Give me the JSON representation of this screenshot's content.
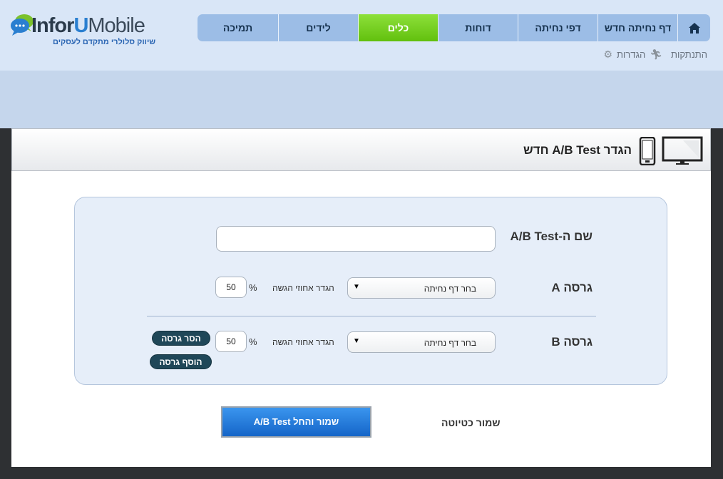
{
  "brand": {
    "name_part1": "Infor",
    "name_part2": "U",
    "name_part3": "Mobile",
    "tagline": "שיווק סלולרי מתקדם לעסקים",
    "accent": "#2a7fd0"
  },
  "nav": {
    "home_icon": "home-icon",
    "items": [
      {
        "label": "דף נחיתה חדש"
      },
      {
        "label": "דפי נחיתה"
      },
      {
        "label": "דוחות"
      },
      {
        "label": "כלים",
        "active": true
      },
      {
        "label": "לידים"
      },
      {
        "label": "תמיכה"
      }
    ],
    "active_color": "#6dc81a"
  },
  "userbar": {
    "settings_label": "הגדרות",
    "settings_icon": "gear-icon",
    "logout_label": "התנתקות",
    "logout_icon": "running-man-icon"
  },
  "panel": {
    "title": "הגדר A/B Test חדש",
    "desktop_icon": "monitor-icon",
    "mobile_icon": "phone-icon"
  },
  "form": {
    "name_label": "שם ה-A/B Test",
    "name_value": "",
    "versions": [
      {
        "label": "גרסה A",
        "select_value": "בחר דף נחיתה",
        "percent_label": "הגדר אחוזי הגשה",
        "percent_sign": "%",
        "percent_value": "50"
      },
      {
        "label": "גרסה B",
        "select_value": "בחר דף נחיתה",
        "percent_label": "הגדר אחוזי הגשה",
        "percent_sign": "%",
        "percent_value": "50"
      }
    ],
    "remove_version_label": "הסר גרסה",
    "add_version_label": "הוסף גרסה"
  },
  "actions": {
    "save_start_label": "שמור והחל A/B Test",
    "save_draft_label": "שמור כטיוטה"
  }
}
